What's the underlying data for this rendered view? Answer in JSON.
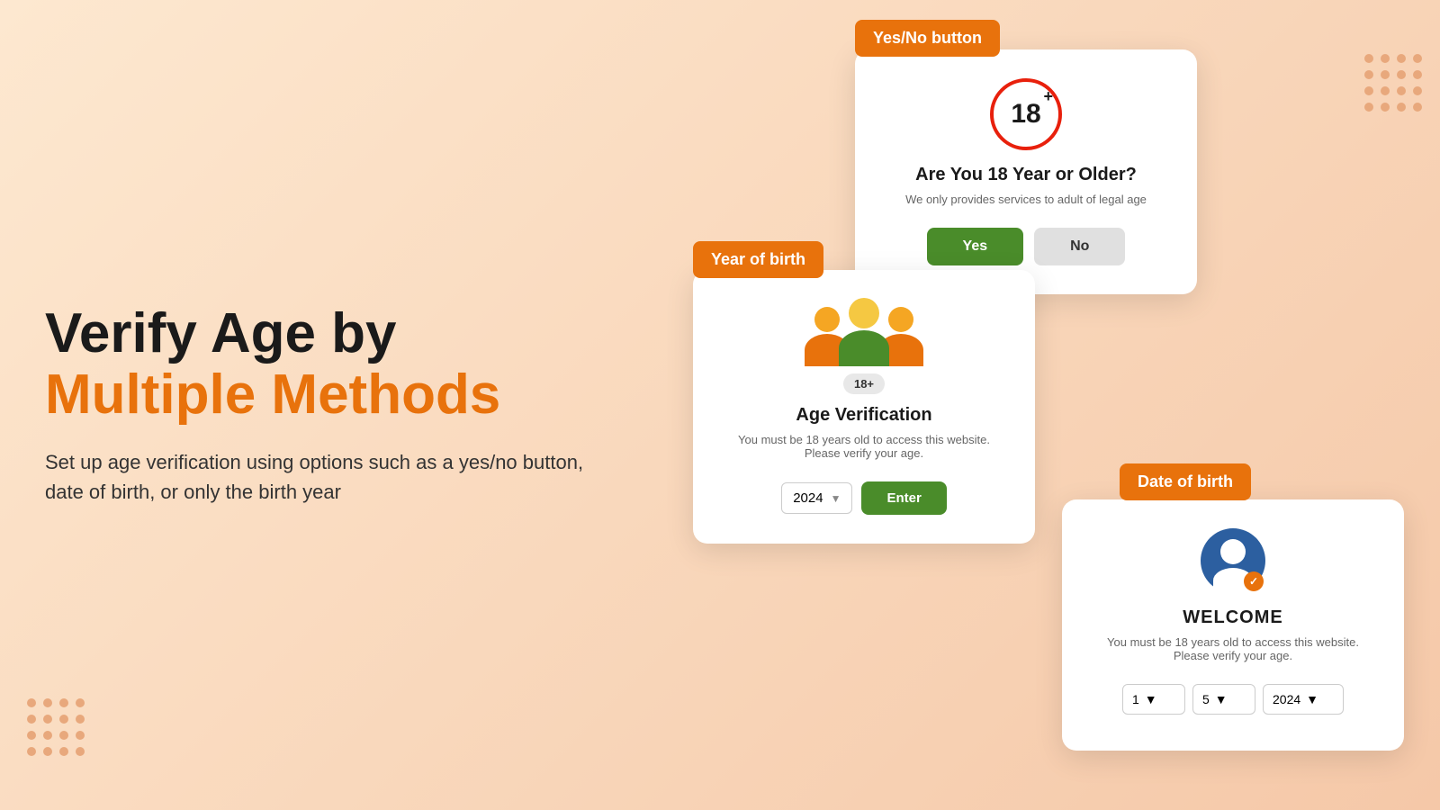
{
  "page": {
    "background": "linear-gradient(135deg, #fde8d0, #f5c8a8)"
  },
  "left": {
    "title_part1": "Verify Age by ",
    "title_highlight": "Multiple Methods",
    "subtitle": "Set up age verification using options such as a yes/no button, date of birth, or only the birth year"
  },
  "tags": {
    "yes_no": "Yes/No button",
    "year_of_birth": "Year of birth",
    "date_of_birth": "Date of birth"
  },
  "card_yesno": {
    "icon_text": "18",
    "icon_plus": "+",
    "title": "Are You 18 Year or Older?",
    "subtitle": "We only provides services to adult of legal age",
    "btn_yes": "Yes",
    "btn_no": "No"
  },
  "card_year": {
    "age_badge": "18+",
    "title": "Age Verification",
    "subtitle_line1": "You must be 18 years old to access this website.",
    "subtitle_line2": "Please verify your age.",
    "year_value": "2024",
    "btn_enter": "Enter"
  },
  "card_dob": {
    "title": "WELCOME",
    "subtitle_line1": "You must be 18 years old to access this website.",
    "subtitle_line2": "Please verify your age.",
    "day_value": "1",
    "month_value": "5",
    "year_value": "2024"
  }
}
